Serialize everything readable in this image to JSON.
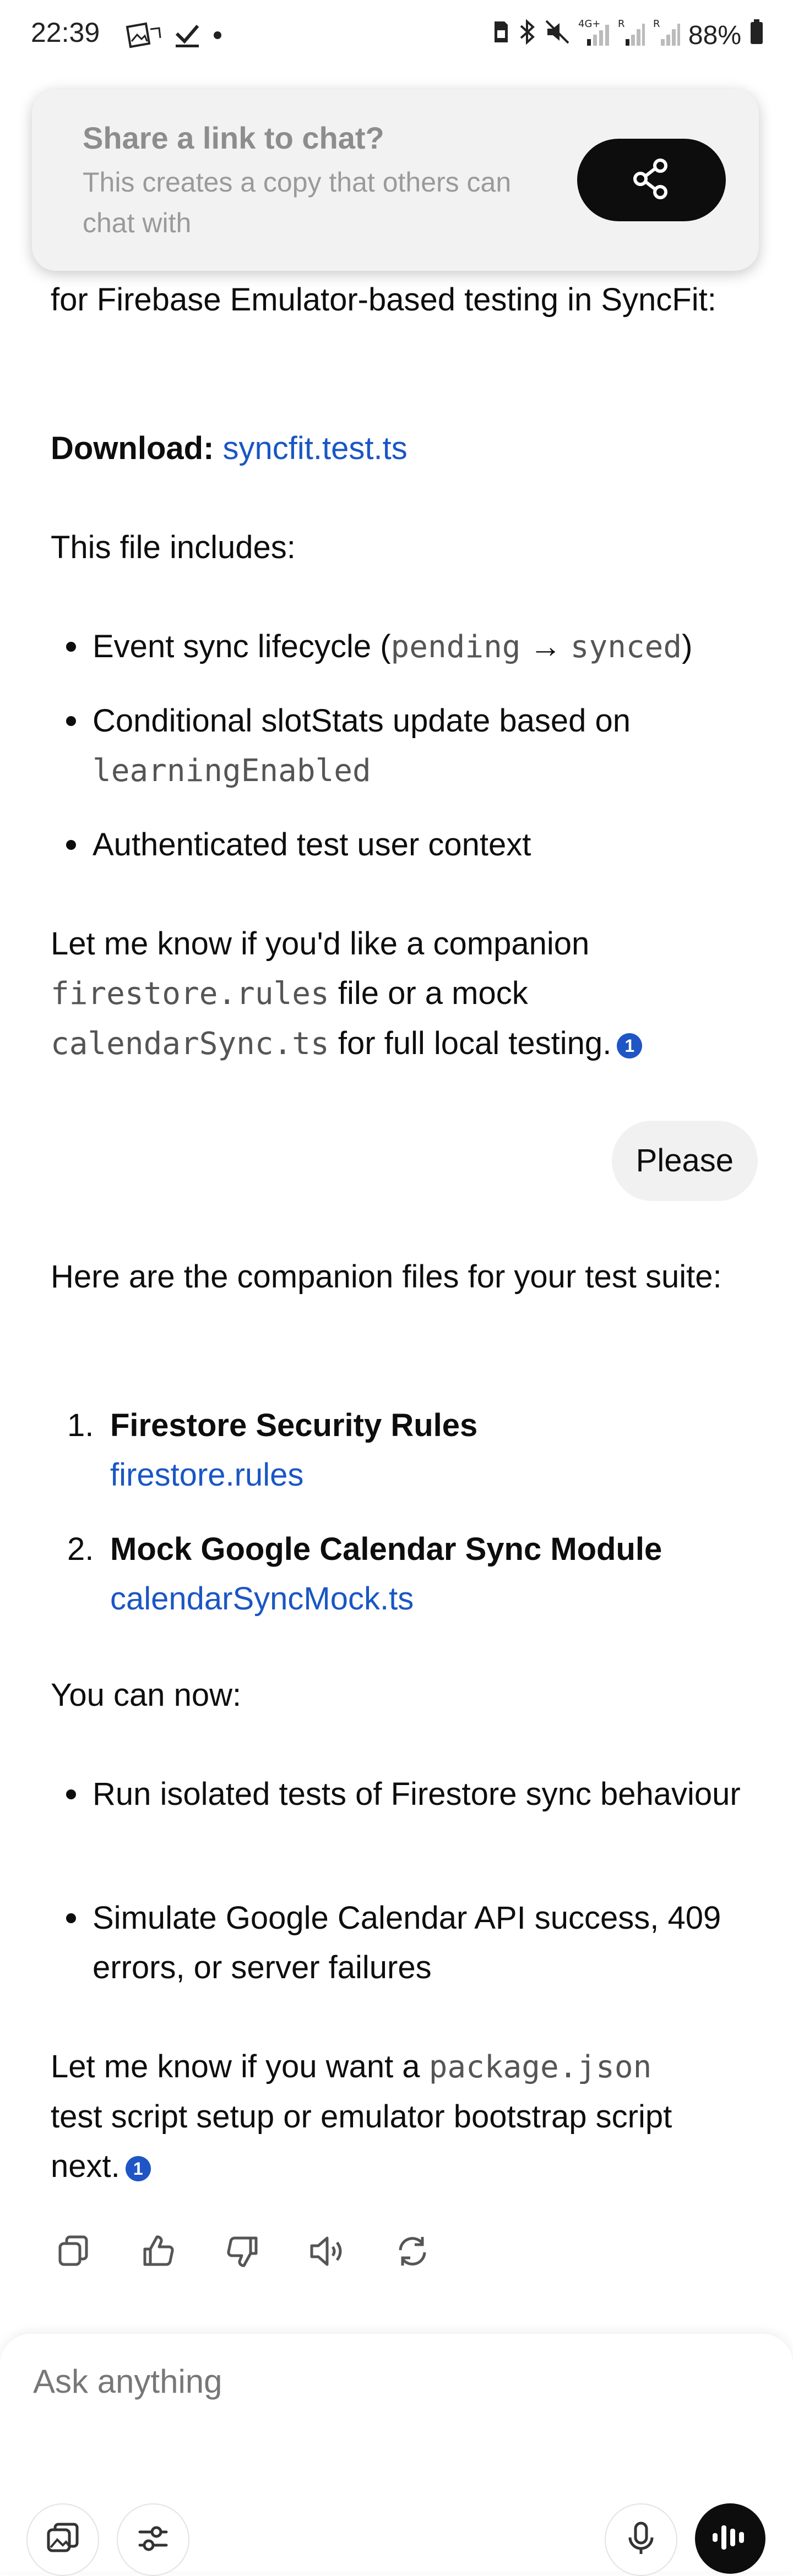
{
  "status": {
    "time": "22:39",
    "battery": "88%",
    "left_icons": [
      "gallery-sync-icon",
      "checkmark-icon",
      "dot-icon"
    ],
    "right_icons": [
      "sim-icon",
      "bluetooth-icon",
      "mute-icon",
      "signal-4g-icon",
      "signal-r-icon",
      "signal-r2-icon",
      "battery-icon"
    ],
    "net_4g": "4G+",
    "net_r": "R"
  },
  "share_prompt": {
    "title": "Share a link to chat?",
    "subtitle": "This creates a copy that others can chat with",
    "button_icon": "share-icon"
  },
  "messages": {
    "intro_tail": "for Firebase Emulator-based testing in SyncFit:",
    "download_label": "Download:",
    "download_link": "syncfit.test.ts",
    "includes_heading": "This file includes:",
    "includes": {
      "item1_prefix": "Event sync lifecycle (",
      "item1_code1": "pending",
      "item1_arrow": " → ",
      "item1_code2": "synced",
      "item1_suffix": ")",
      "item2_text": "Conditional slotStats update based on",
      "item2_code": "learningEnabled",
      "item3_text": "Authenticated test user context"
    },
    "followup": {
      "prefix": "Let me know if you'd like a companion",
      "code1": "firestore.rules",
      "middle": " file or a mock",
      "code2": "calendarSync.ts",
      "suffix": " for full local testing.",
      "citation": "1"
    },
    "user_message": "Please",
    "companion_heading": "Here are the companion files for your test suite:",
    "files": [
      {
        "num": "1.",
        "title": "Firestore Security Rules",
        "link": "firestore.rules"
      },
      {
        "num": "2.",
        "title": "Mock Google Calendar Sync Module",
        "link": "calendarSyncMock.ts"
      }
    ],
    "can_now": "You can now:",
    "capabilities": [
      "Run isolated tests of Firestore sync behaviour",
      "Simulate Google Calendar API success, 409 errors, or server failures"
    ],
    "final": {
      "prefix": "Let me know if you want a",
      "code": "package.json",
      "suffix": "test script setup or emulator bootstrap script next.",
      "citation": "1"
    }
  },
  "actions": [
    "copy-icon",
    "thumbs-up-icon",
    "thumbs-down-icon",
    "read-aloud-icon",
    "regenerate-icon"
  ],
  "composer": {
    "placeholder": "Ask anything",
    "buttons": [
      "attach-image-icon",
      "tools-icon",
      "microphone-icon",
      "voice-mode-icon"
    ]
  }
}
